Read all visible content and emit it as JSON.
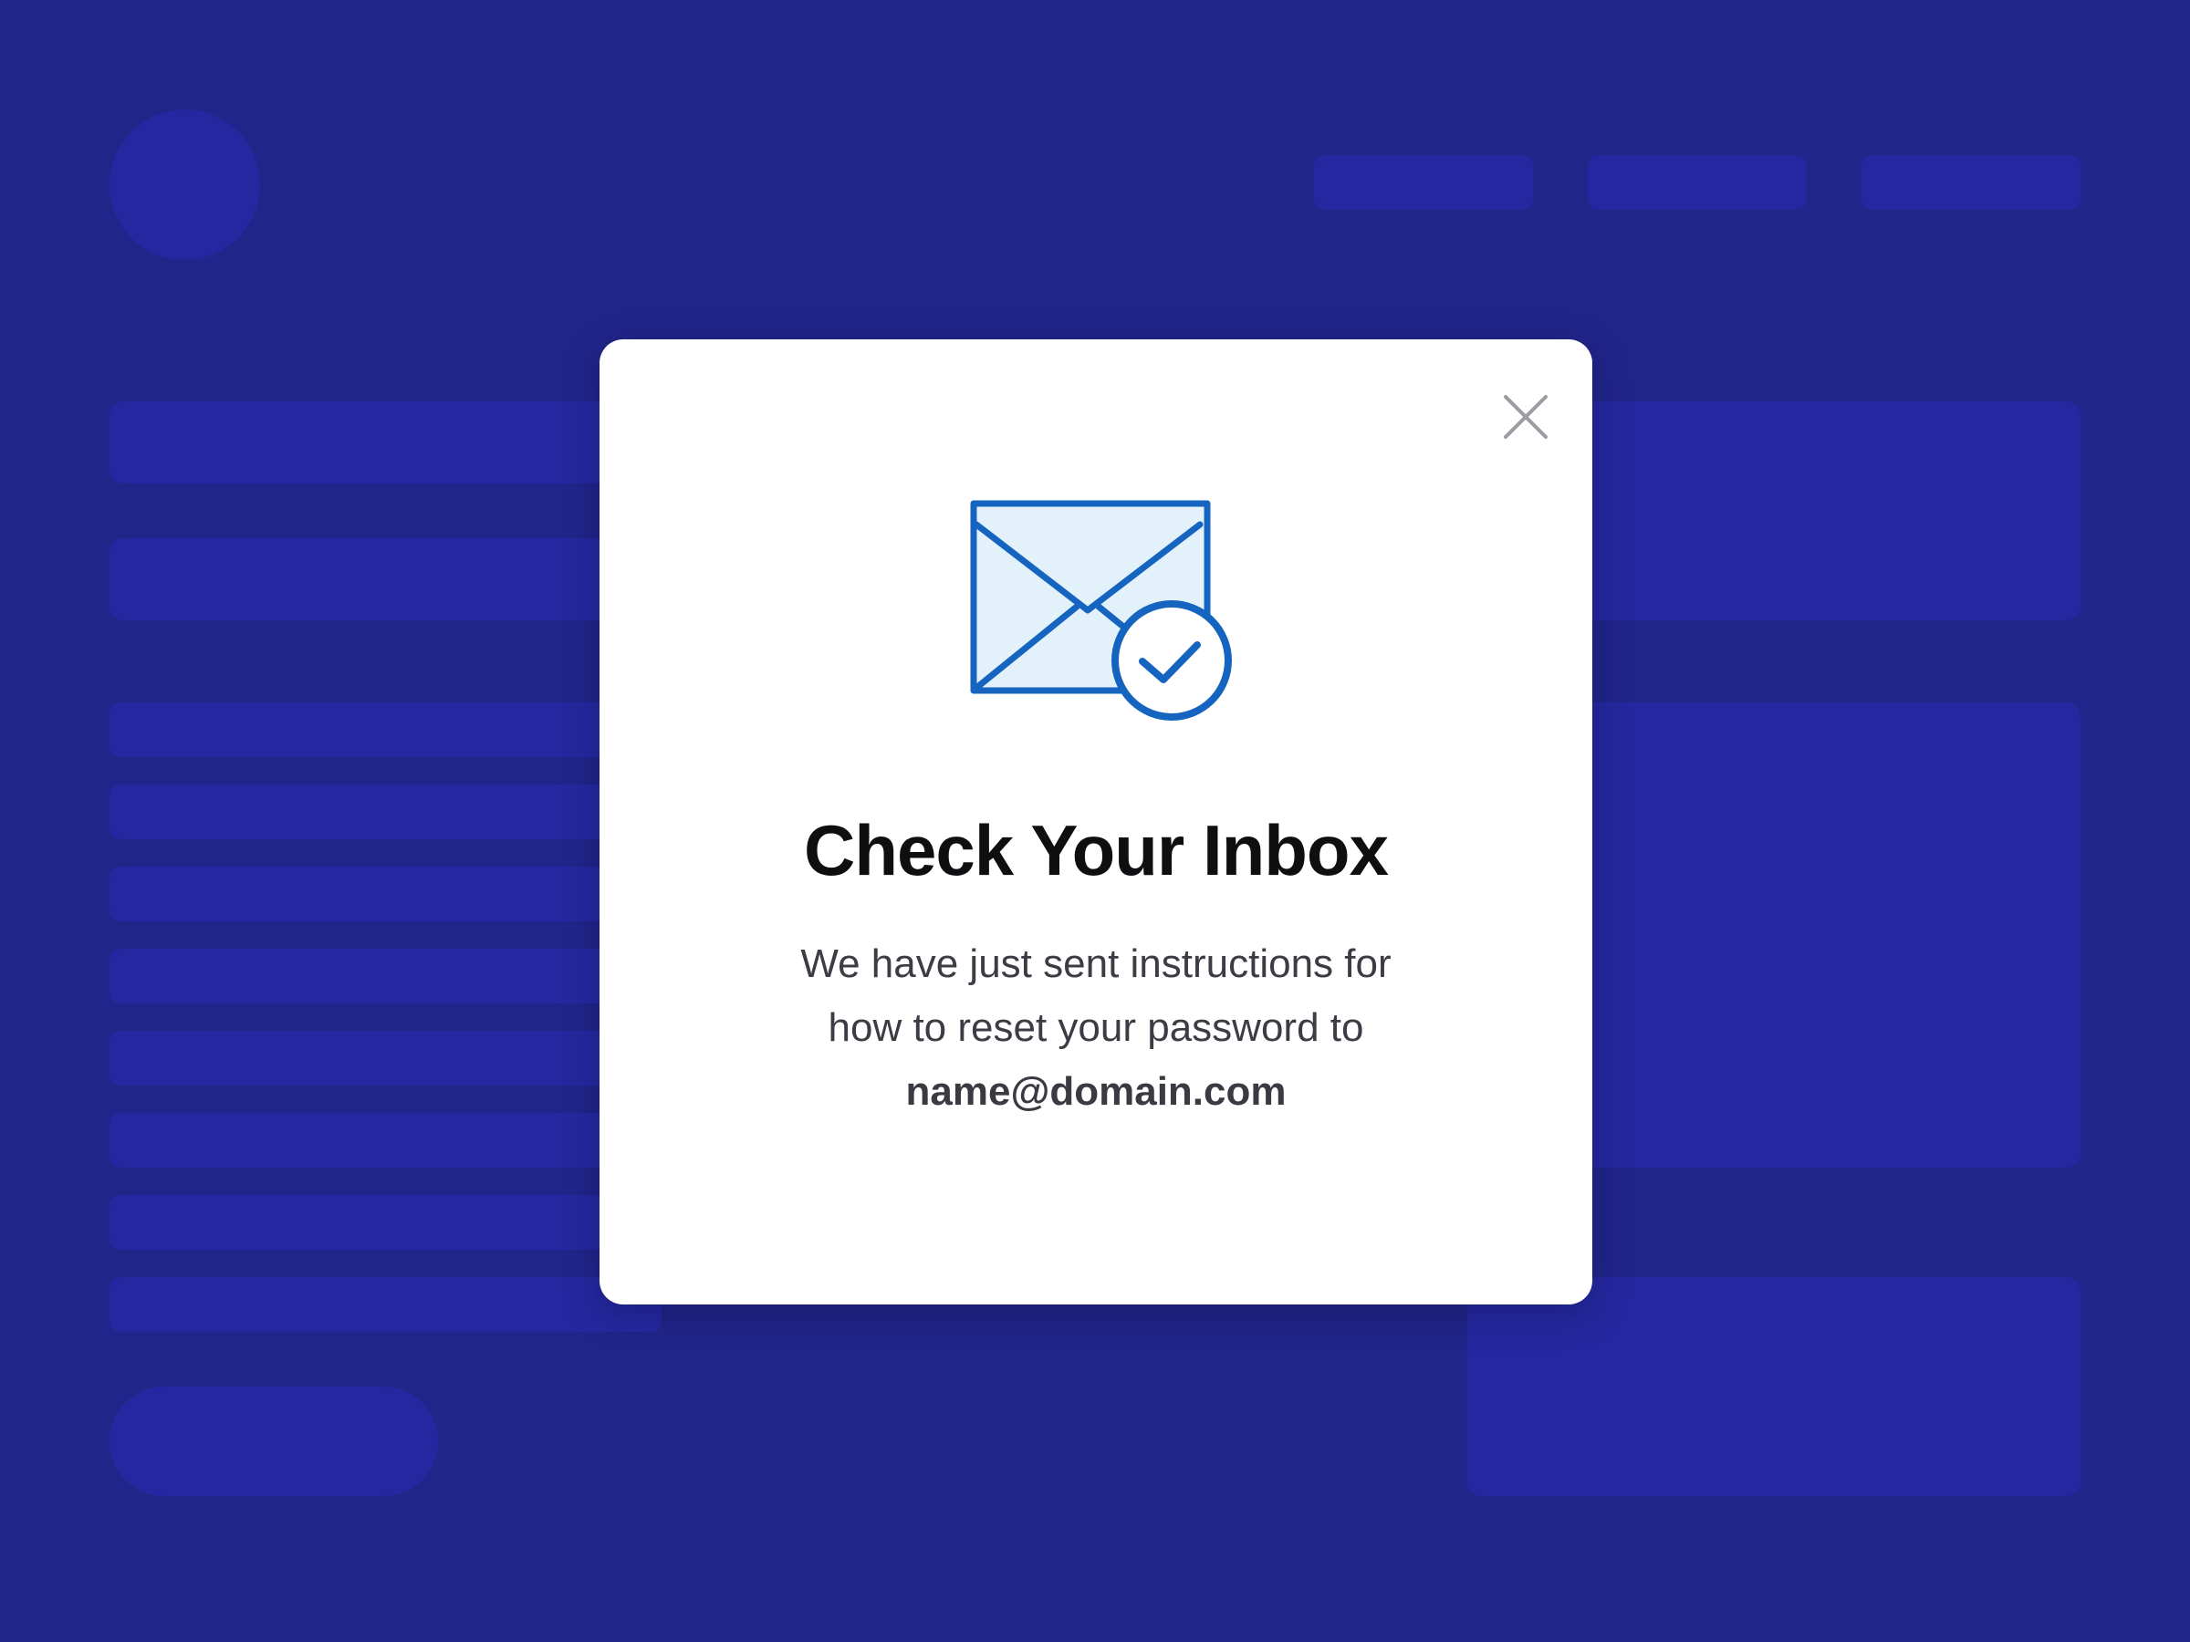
{
  "colors": {
    "background": "#20258a",
    "placeholder": "#2428a0",
    "modal_bg": "#ffffff",
    "accent": "#1565c0",
    "icon_fill": "#e3f1fb",
    "close_icon": "#9b9ba2"
  },
  "modal": {
    "title": "Check Your Inbox",
    "message_line1": "We have just sent instructions for",
    "message_line2": "how to reset your password to",
    "email": "name@domain.com",
    "close_icon": "close-icon",
    "illustration_icon": "envelope-check-icon"
  }
}
